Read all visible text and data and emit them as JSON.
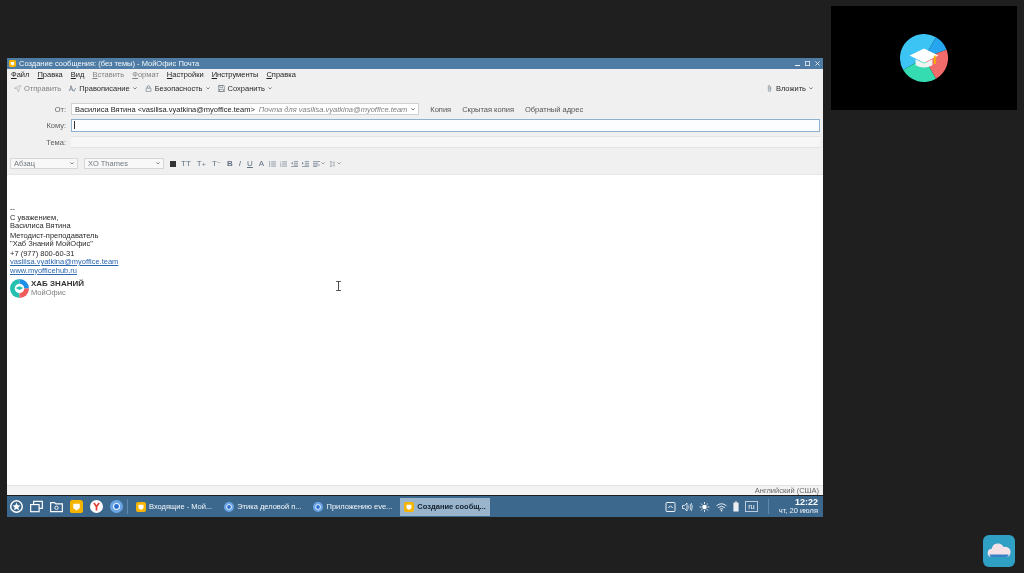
{
  "window": {
    "title": "Создание сообщения: (без темы) - МойОфис Почта"
  },
  "menu": [
    {
      "label": "Файл",
      "disabled": false
    },
    {
      "label": "Правка",
      "disabled": false
    },
    {
      "label": "Вид",
      "disabled": false
    },
    {
      "label": "Вставить",
      "disabled": true
    },
    {
      "label": "Формат",
      "disabled": true
    },
    {
      "label": "Настройки",
      "disabled": false
    },
    {
      "label": "Инструменты",
      "disabled": false
    },
    {
      "label": "Справка",
      "disabled": false
    }
  ],
  "toolbar": {
    "left": [
      {
        "kind": "send",
        "label": "Отправить",
        "disabled": true,
        "dropdown": false
      },
      {
        "kind": "spelling",
        "label": "Правописание",
        "disabled": false,
        "dropdown": true
      },
      {
        "kind": "security",
        "label": "Безопасность",
        "disabled": false,
        "dropdown": true
      },
      {
        "kind": "save",
        "label": "Сохранить",
        "disabled": false,
        "dropdown": true
      }
    ],
    "right": [
      {
        "kind": "attach",
        "label": "Вложить",
        "disabled": false,
        "dropdown": true
      }
    ]
  },
  "header": {
    "from": {
      "label": "От:",
      "value": "Василиса Вятина <vasilisa.vyatkina@myoffice.team>",
      "hint": "Почта для vasilisa.vyatkina@myoffice.team"
    },
    "links": [
      "Копия",
      "Скрытая копия",
      "Обратный адрес"
    ],
    "fields": [
      {
        "label": "Кому:",
        "focused": true
      },
      {
        "label": "Тема:",
        "focused": false
      }
    ]
  },
  "format_bar": {
    "style": "Абзац",
    "font": "XO Thames",
    "tools": [
      {
        "kind": "swatch",
        "dropdown": false
      },
      {
        "kind": "glyph",
        "label": "TT"
      },
      {
        "kind": "glyph",
        "label": "T₊"
      },
      {
        "kind": "glyph",
        "label": "T⁻"
      },
      {
        "kind": "bold",
        "label": "B"
      },
      {
        "kind": "italic",
        "label": "I"
      },
      {
        "kind": "underline",
        "label": "U"
      },
      {
        "kind": "glyph",
        "label": "A"
      },
      {
        "kind": "bullets",
        "dropdown": false
      },
      {
        "kind": "numbers",
        "dropdown": false
      },
      {
        "kind": "outdent",
        "dropdown": false
      },
      {
        "kind": "indent",
        "dropdown": false
      },
      {
        "kind": "align",
        "dropdown": true
      },
      {
        "kind": "spacing",
        "dropdown": true
      }
    ]
  },
  "body": {
    "signature": {
      "separator": "--",
      "paragraphs": [
        [
          {
            "kind": "text",
            "text": "С уважением,"
          },
          {
            "kind": "text",
            "text": "Василиса Вятина"
          }
        ],
        [
          {
            "kind": "text",
            "text": "Методист-преподаватель"
          },
          {
            "kind": "text",
            "text": "\"Хаб Знаний МойОфис\""
          }
        ],
        [
          {
            "kind": "text",
            "text": "+7 (977) 800-60-31"
          },
          {
            "kind": "link",
            "text": "vasilisa.vyatkina@myoffice.team"
          },
          {
            "kind": "link",
            "text": "www.myofficehub.ru"
          }
        ]
      ],
      "logo": {
        "title": "ХАБ ЗНАНИЙ",
        "subtitle": "МойОфис"
      }
    }
  },
  "status_bar": {
    "language": "Английский (США)"
  },
  "taskbar": {
    "launchers": [
      {
        "kind": "start"
      },
      {
        "kind": "windows"
      },
      {
        "kind": "files"
      },
      {
        "kind": "mail"
      },
      {
        "kind": "yandex"
      },
      {
        "kind": "chromium"
      }
    ],
    "tasks": [
      {
        "kind": "mail",
        "label": "Входящие - Мой...",
        "selected": false
      },
      {
        "kind": "chromium",
        "label": "Этика деловой п...",
        "selected": false
      },
      {
        "kind": "chromium",
        "label": "Приложению eve...",
        "selected": false
      },
      {
        "kind": "mail",
        "label": "Создание сообщ...",
        "selected": true
      }
    ],
    "tray": {
      "layout": "ru",
      "time": "12:22",
      "date": "чт, 20 июля"
    }
  }
}
